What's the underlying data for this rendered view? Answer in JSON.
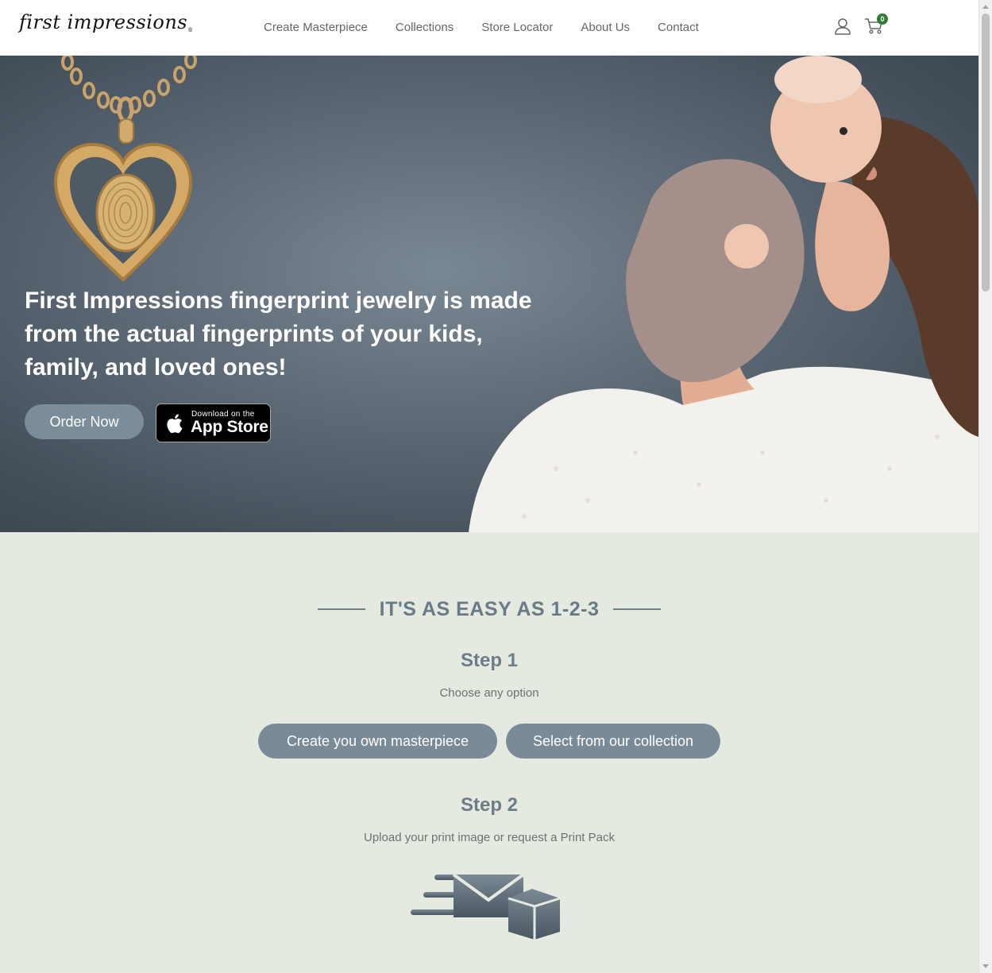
{
  "header": {
    "logo_text": "first impressions",
    "logo_mark": "®",
    "nav": [
      "Create Masterpiece",
      "Collections",
      "Store Locator",
      "About Us",
      "Contact"
    ],
    "cart_count": "0"
  },
  "hero": {
    "title": "First Impressions fingerprint jewelry is made from the actual fingerprints of your kids, family, and loved ones!",
    "order_button": "Order Now",
    "appstore_small": "Download on the",
    "appstore_big": "App Store"
  },
  "steps": {
    "section_title": "IT'S AS EASY AS 1-2-3",
    "step1_title": "Step 1",
    "step1_sub": "Choose any option",
    "step1_buttons": [
      "Create you own masterpiece",
      "Select from our collection"
    ],
    "step2_title": "Step 2",
    "step2_sub": "Upload your print image or request a Print Pack"
  },
  "colors": {
    "accent": "#7a8a96",
    "section_bg": "#e4eae0",
    "cart_badge": "#2e7d32"
  },
  "icons": [
    "user-icon",
    "cart-icon",
    "apple-icon",
    "print-pack-icon"
  ]
}
